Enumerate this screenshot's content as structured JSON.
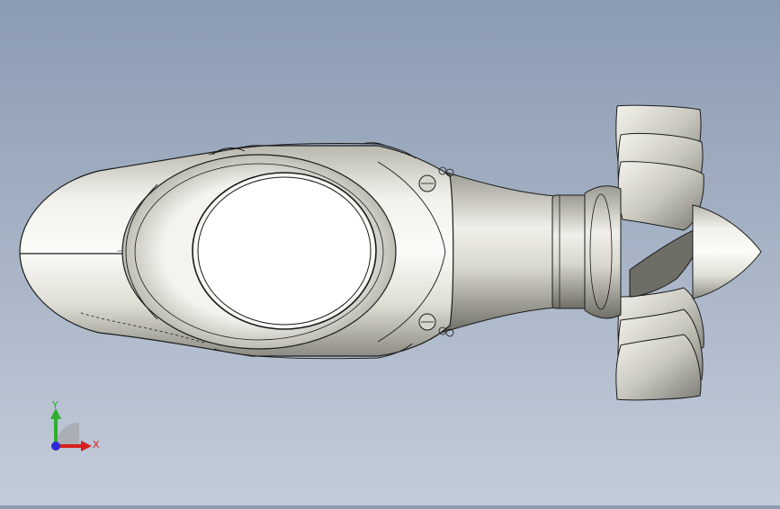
{
  "viewport": {
    "background_top": "#8b9bb2",
    "background_bottom": "#c3ccd9",
    "model_fill": "#e9e8e2",
    "model_stroke": "#1b1b1b"
  },
  "triad": {
    "x_label": "X",
    "y_label": "Y",
    "x_color": "#d62020",
    "y_color": "#2fae2f",
    "z_color": "#2a2ad6"
  }
}
